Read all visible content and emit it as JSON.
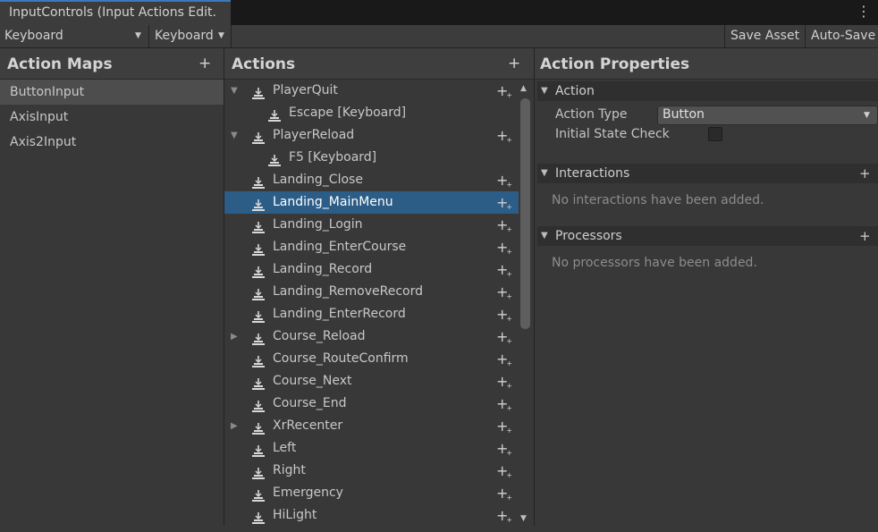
{
  "window": {
    "tab_title": "InputControls (Input Actions Edit."
  },
  "toolbar": {
    "control_scheme": "Keyboard",
    "device": "Keyboard",
    "save_asset": "Save Asset",
    "auto_save": "Auto-Save"
  },
  "action_maps": {
    "title": "Action Maps",
    "items": [
      "ButtonInput",
      "AxisInput",
      "Axis2Input"
    ],
    "selected": "ButtonInput"
  },
  "actions": {
    "title": "Actions",
    "rows": [
      {
        "label": "PlayerQuit",
        "level": 0,
        "fold": "expanded",
        "add": true
      },
      {
        "label": "Escape [Keyboard]",
        "level": 1,
        "fold": "none",
        "add": false
      },
      {
        "label": "PlayerReload",
        "level": 0,
        "fold": "expanded",
        "add": true
      },
      {
        "label": "F5 [Keyboard]",
        "level": 1,
        "fold": "none",
        "add": false
      },
      {
        "label": "Landing_Close",
        "level": 0,
        "fold": "none",
        "add": true
      },
      {
        "label": "Landing_MainMenu",
        "level": 0,
        "fold": "none",
        "add": true,
        "selected": true
      },
      {
        "label": "Landing_Login",
        "level": 0,
        "fold": "none",
        "add": true
      },
      {
        "label": "Landing_EnterCourse",
        "level": 0,
        "fold": "none",
        "add": true
      },
      {
        "label": "Landing_Record",
        "level": 0,
        "fold": "none",
        "add": true
      },
      {
        "label": "Landing_RemoveRecord",
        "level": 0,
        "fold": "none",
        "add": true
      },
      {
        "label": "Landing_EnterRecord",
        "level": 0,
        "fold": "none",
        "add": true
      },
      {
        "label": "Course_Reload",
        "level": 0,
        "fold": "collapsed",
        "add": true
      },
      {
        "label": "Course_RouteConfirm",
        "level": 0,
        "fold": "none",
        "add": true
      },
      {
        "label": "Course_Next",
        "level": 0,
        "fold": "none",
        "add": true
      },
      {
        "label": "Course_End",
        "level": 0,
        "fold": "none",
        "add": true
      },
      {
        "label": "XrRecenter",
        "level": 0,
        "fold": "collapsed",
        "add": true
      },
      {
        "label": "Left",
        "level": 0,
        "fold": "none",
        "add": true
      },
      {
        "label": "Right",
        "level": 0,
        "fold": "none",
        "add": true
      },
      {
        "label": "Emergency",
        "level": 0,
        "fold": "none",
        "add": true
      },
      {
        "label": "HiLight",
        "level": 0,
        "fold": "none",
        "add": true
      }
    ]
  },
  "properties": {
    "title": "Action Properties",
    "action_section": "Action",
    "action_type_label": "Action Type",
    "action_type_value": "Button",
    "initial_state_label": "Initial State Check",
    "initial_state_checked": false,
    "interactions_section": "Interactions",
    "interactions_empty": "No interactions have been added.",
    "processors_section": "Processors",
    "processors_empty": "No processors have been added."
  },
  "icons": {
    "add": "plus-icon",
    "add_binding": "add-binding-icon",
    "action": "action-icon",
    "binding": "binding-icon",
    "menu": "kebab-menu-icon"
  },
  "colors": {
    "selection": "#2c5d87",
    "tab_accent": "#3a79bb"
  }
}
